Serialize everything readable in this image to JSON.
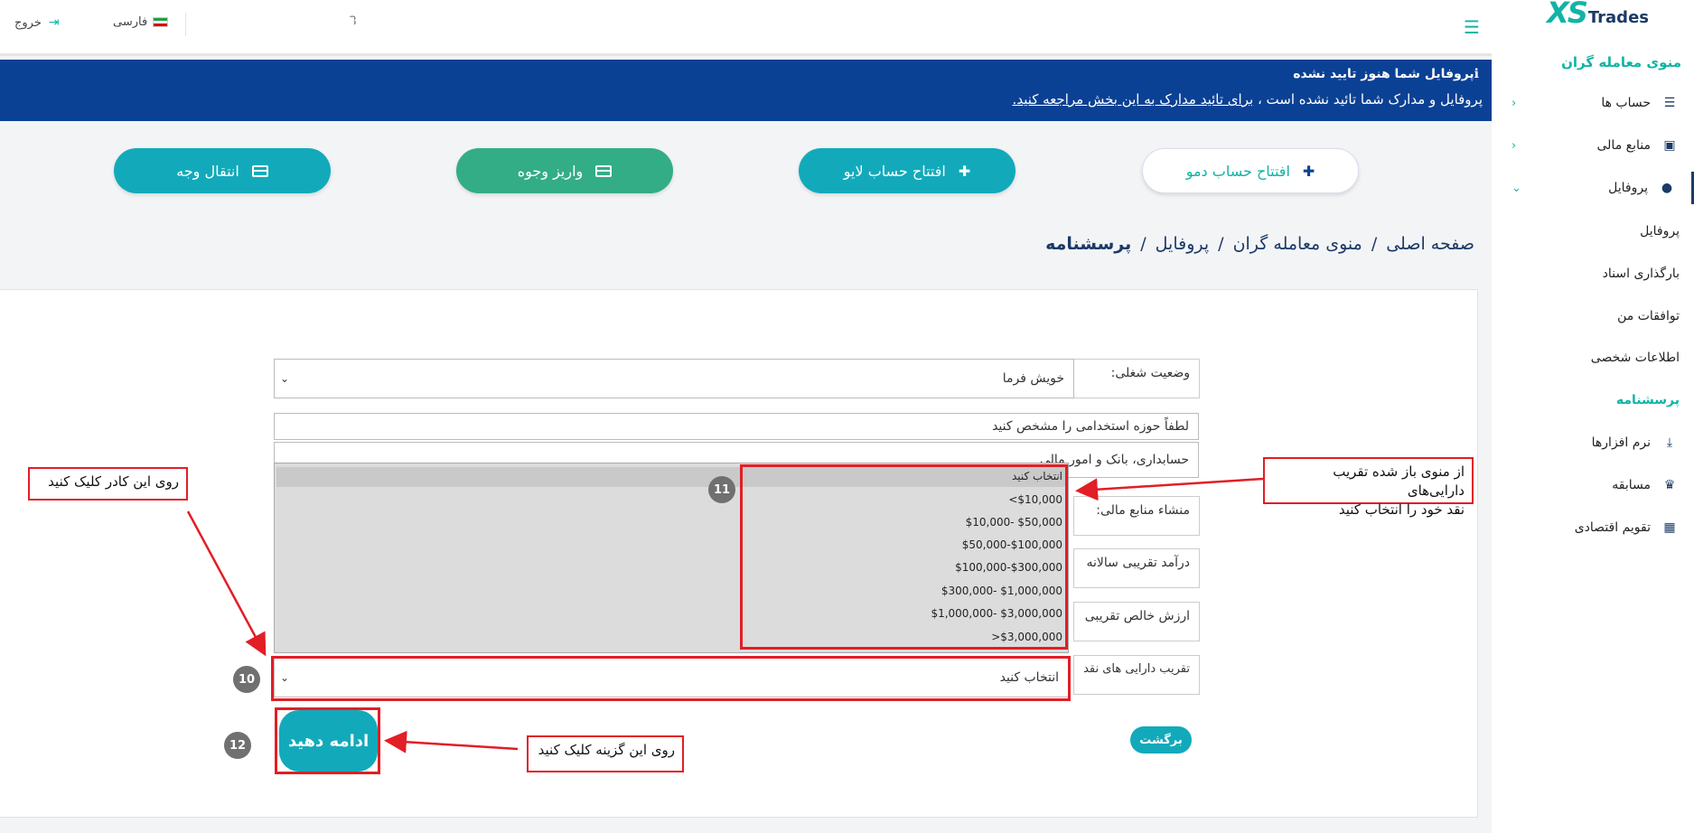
{
  "sidebar": {
    "logo_xs": "XS",
    "logo_trades": "Trades",
    "menu_title": "منوی معامله گران",
    "items": [
      {
        "label": "حساب ها",
        "icon": "list-icon"
      },
      {
        "label": "منابع مالی",
        "icon": "wallet-icon"
      },
      {
        "label": "پروفایل",
        "icon": "user-icon"
      }
    ],
    "profile_sub": [
      {
        "label": "پروفایل"
      },
      {
        "label": "بارگذاری اسناد"
      },
      {
        "label": "توافقات من"
      },
      {
        "label": "اطلاعات شخصی"
      },
      {
        "label": "پرسشنامه"
      }
    ],
    "items_lower": [
      {
        "label": "نرم افزارها",
        "icon": "download-icon"
      },
      {
        "label": "مسابقه",
        "icon": "trophy-icon"
      },
      {
        "label": "تقویم اقتصادی",
        "icon": "calendar-icon"
      }
    ]
  },
  "topbar": {
    "logout_label": "خروج",
    "language_label": "فارسی",
    "user_fragment": "3"
  },
  "notice": {
    "title": "پروفایل شما هنوز تایید نشده",
    "body_prefix": "پروفایل و مدارک شما تائید نشده است ، ",
    "link_text": "برای تائید مدارک به این بخش مراجعه کنید."
  },
  "actions": {
    "demo": "افتتاح حساب دمو",
    "live": "افتتاح حساب لایو",
    "deposit": "واریز وجوه",
    "transfer": "انتقال وجه"
  },
  "breadcrumb": {
    "home": "صفحه اصلی",
    "traders_menu": "منوی معامله گران",
    "profile": "پروفایل",
    "current": "پرسشنامه"
  },
  "form": {
    "employment_label": "وضعیت شغلی:",
    "employment_value": "خویش فرما",
    "industry_prompt": "لطفاً حوزه استخدامی را مشخص کنید",
    "industry_value": "حسابداری، بانک و امور مالی",
    "source_label": "منشاء منابع مالی:",
    "income_label": "درآمد تقریبی سالانه",
    "networth_label": "ارزش خالص تقریبی",
    "cash_label": "تقریب دارایی های نقد",
    "cash_value": "انتخاب کنید",
    "continue": "ادامه دهید",
    "back": "برگشت"
  },
  "dropdown": {
    "options": [
      "انتخاب کنید",
      "<$10,000",
      "$10,000- $50,000",
      "$50,000-$100,000",
      "$100,000-$300,000",
      "$300,000- $1,000,000",
      "$1,000,000- $3,000,000",
      ">$3,000,000"
    ]
  },
  "annotations": {
    "click_box": "روی این کادر کلیک کنید",
    "choose_menu_line1": "از منوی باز شده تقریب دارایی‌های",
    "choose_menu_line2": "نقد خود را انتخاب کنید",
    "click_option": "روی این گزینه کلیک کنید",
    "step_10": "10",
    "step_11": "11",
    "step_12": "12"
  },
  "colors": {
    "accent": "#12aabb",
    "brand_navy": "#0b4194",
    "deposit_green": "#33ad85",
    "annotation_red": "#e21e26"
  }
}
